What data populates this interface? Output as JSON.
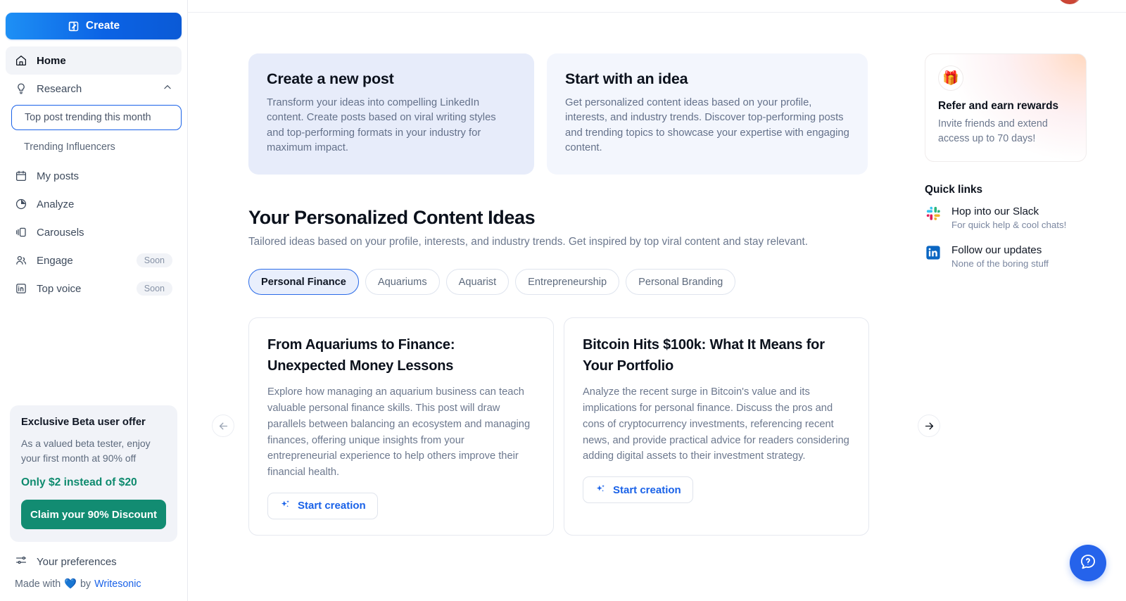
{
  "sidebar": {
    "create_label": "Create",
    "nav": [
      {
        "label": "Home",
        "icon": "home-icon",
        "badge": ""
      },
      {
        "label": "Research",
        "icon": "lightbulb-icon",
        "badge": ""
      },
      {
        "label": "My posts",
        "icon": "calendar-icon",
        "badge": ""
      },
      {
        "label": "Analyze",
        "icon": "pie-chart-icon",
        "badge": ""
      },
      {
        "label": "Carousels",
        "icon": "carousel-icon",
        "badge": ""
      },
      {
        "label": "Engage",
        "icon": "users-icon",
        "badge": "Soon"
      },
      {
        "label": "Top voice",
        "icon": "linkedin-icon",
        "badge": "Soon"
      }
    ],
    "research_sub": [
      {
        "label": "Top post trending this month"
      },
      {
        "label": "Trending Influencers"
      }
    ],
    "beta": {
      "title": "Exclusive Beta user offer",
      "subtitle": "As a valued beta tester, enjoy your first month at 90% off",
      "price": "Only $2 instead of $20",
      "cta": "Claim your 90% Discount"
    },
    "preferences_label": "Your preferences",
    "footer_prefix": "Made with",
    "footer_heart": "💙",
    "footer_mid": "by",
    "footer_brand": "Writesonic"
  },
  "top_cards": [
    {
      "title": "Create a new post",
      "body": "Transform your ideas into compelling LinkedIn content. Create posts based on viral writing styles and top-performing formats in your industry for maximum impact."
    },
    {
      "title": "Start with an idea",
      "body": "Get personalized content ideas based on your profile, interests, and industry trends. Discover top-performing posts and trending topics to showcase your expertise with engaging content."
    }
  ],
  "ideas_section": {
    "title": "Your Personalized Content Ideas",
    "subtitle": "Tailored ideas based on your profile, interests, and industry trends. Get inspired by top viral content and stay relevant.",
    "pills": [
      "Personal Finance",
      "Aquariums",
      "Aquarist",
      "Entrepreneurship",
      "Personal Branding"
    ],
    "active_pill": "Personal Finance",
    "cards": [
      {
        "title": "From Aquariums to Finance: Unexpected Money Lessons",
        "body": "Explore how managing an aquarium business can teach valuable personal finance skills. This post will draw parallels between balancing an ecosystem and managing finances, offering unique insights from your entrepreneurial experience to help others improve their financial health.",
        "cta": "Start creation"
      },
      {
        "title": "Bitcoin Hits $100k: What It Means for Your Portfolio",
        "body": "Analyze the recent surge in Bitcoin's value and its implications for personal finance. Discuss the pros and cons of cryptocurrency investments, referencing recent news, and provide practical advice for readers considering adding digital assets to their investment strategy.",
        "cta": "Start creation"
      }
    ]
  },
  "right_rail": {
    "refer": {
      "emoji": "🎁",
      "title": "Refer and earn rewards",
      "subtitle": "Invite friends and extend access up to 70 days!"
    },
    "quick_links_title": "Quick links",
    "quick_links": [
      {
        "name": "Hop into our Slack",
        "desc": "For quick help & cool chats!",
        "icon": "slack-icon"
      },
      {
        "name": "Follow our updates",
        "desc": "None of the boring stuff",
        "icon": "linkedin-icon"
      }
    ]
  },
  "colors": {
    "accent_blue": "#1a62e8",
    "create_gradient_start": "#1e90f5",
    "create_gradient_end": "#0b5ad6",
    "beta_green": "#128c72",
    "pill_active_bg": "#e9effc",
    "help_fab": "#2563eb"
  }
}
